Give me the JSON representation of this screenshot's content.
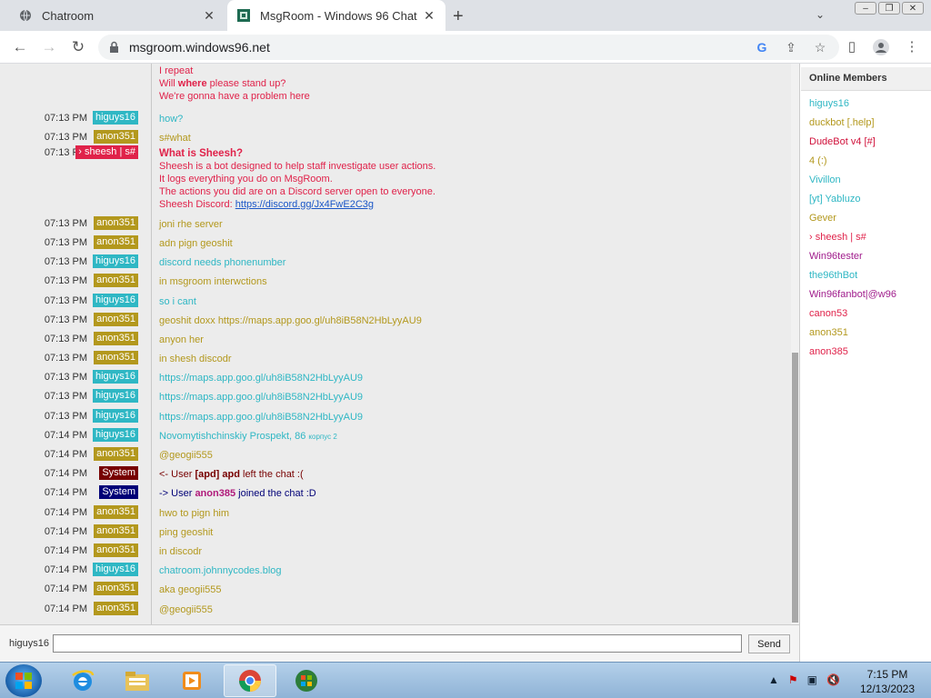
{
  "browser": {
    "tabs": [
      {
        "title": "Chatroom"
      },
      {
        "title": "MsgRoom - Windows 96 Chat"
      }
    ],
    "url": "msgroom.windows96.net"
  },
  "chat": {
    "top_lines": [
      {
        "text": "I repeat"
      },
      {
        "pre": "Will ",
        "bold": "where",
        "post": " please stand up?"
      },
      {
        "text": "We're gonna have a problem here"
      }
    ],
    "messages": [
      {
        "time": "07:13 PM",
        "user": "higuys16",
        "style": "hig",
        "text": "how?"
      },
      {
        "time": "07:13 PM",
        "user": "anon351",
        "style": "anon",
        "text": "s#what"
      },
      {
        "time": "07:13 PM",
        "user": "› sheesh | s#",
        "style": "shee",
        "title": "What is Sheesh?",
        "lines": [
          "Sheesh is a bot designed to help staff investigate user actions.",
          "It logs everything you do on MsgRoom.",
          "The actions you did are on a Discord server open to everyone."
        ],
        "link_label": "Sheesh Discord: ",
        "link": "https://discord.gg/Jx4FwE2C3g"
      },
      {
        "time": "07:13 PM",
        "user": "anon351",
        "style": "anon",
        "text": "joni rhe server"
      },
      {
        "time": "07:13 PM",
        "user": "anon351",
        "style": "anon",
        "text": "adn pign geoshit"
      },
      {
        "time": "07:13 PM",
        "user": "higuys16",
        "style": "hig",
        "text": "discord needs phonenumber"
      },
      {
        "time": "07:13 PM",
        "user": "anon351",
        "style": "anon",
        "text": "in msgroom interwctions"
      },
      {
        "time": "07:13 PM",
        "user": "higuys16",
        "style": "hig",
        "text": "so i cant"
      },
      {
        "time": "07:13 PM",
        "user": "anon351",
        "style": "anon",
        "text": "geoshit doxx https://maps.app.goo.gl/uh8iB58N2HbLyyAU9"
      },
      {
        "time": "07:13 PM",
        "user": "anon351",
        "style": "anon",
        "text": "anyon her"
      },
      {
        "time": "07:13 PM",
        "user": "anon351",
        "style": "anon",
        "text": "in shesh discodr"
      },
      {
        "time": "07:13 PM",
        "user": "higuys16",
        "style": "hig",
        "text": "https://maps.app.goo.gl/uh8iB58N2HbLyyAU9"
      },
      {
        "time": "07:13 PM",
        "user": "higuys16",
        "style": "hig",
        "text": "https://maps.app.goo.gl/uh8iB58N2HbLyyAU9"
      },
      {
        "time": "07:13 PM",
        "user": "higuys16",
        "style": "hig",
        "text": "https://maps.app.goo.gl/uh8iB58N2HbLyyAU9"
      },
      {
        "time": "07:14 PM",
        "user": "higuys16",
        "style": "hig",
        "text": "Novomytishchinskiy Prospekt, 86",
        "small": "корпус 2"
      },
      {
        "time": "07:14 PM",
        "user": "anon351",
        "style": "anon",
        "text": "@geogii555"
      },
      {
        "time": "07:14 PM",
        "user": "System",
        "style": "sys",
        "pre": "<- User ",
        "bold": "[apd] apd",
        "post": " left the chat :("
      },
      {
        "time": "07:14 PM",
        "user": "System",
        "style": "sys2",
        "pre": "-> User ",
        "bold": "anon385",
        "post": " joined the chat :D"
      },
      {
        "time": "07:14 PM",
        "user": "anon351",
        "style": "anon",
        "text": "hwo to pign him"
      },
      {
        "time": "07:14 PM",
        "user": "anon351",
        "style": "anon",
        "text": "ping geoshit"
      },
      {
        "time": "07:14 PM",
        "user": "anon351",
        "style": "anon",
        "text": "in discodr"
      },
      {
        "time": "07:14 PM",
        "user": "higuys16",
        "style": "hig",
        "text": "chatroom.johnnycodes.blog"
      },
      {
        "time": "07:14 PM",
        "user": "anon351",
        "style": "anon",
        "text": "aka geogii555"
      },
      {
        "time": "07:14 PM",
        "user": "anon351",
        "style": "anon",
        "text": "@geogii555"
      }
    ]
  },
  "sidebar": {
    "title": "Online Members",
    "members": [
      {
        "name": "higuys16",
        "color": "#2fb7c4"
      },
      {
        "name": "duckbot [.help]",
        "color": "#b3981d"
      },
      {
        "name": "DudeBot v4 [#]",
        "color": "#d0103a"
      },
      {
        "name": "4 (:)",
        "color": "#b3981d"
      },
      {
        "name": "Vivillon",
        "color": "#2fb7c4"
      },
      {
        "name": "[yt] Yabluzo",
        "color": "#2fb7c4"
      },
      {
        "name": "Gever",
        "color": "#b3981d"
      },
      {
        "name": "› sheesh | s#",
        "color": "#e0224a"
      },
      {
        "name": "Win96tester",
        "color": "#a01c8c"
      },
      {
        "name": "the96thBot",
        "color": "#2fb7c4"
      },
      {
        "name": "Win96fanbot|@w96",
        "color": "#a01c8c"
      },
      {
        "name": "canon53",
        "color": "#e0224a"
      },
      {
        "name": "anon351",
        "color": "#b3981d"
      },
      {
        "name": "anon385",
        "color": "#e0224a"
      }
    ]
  },
  "input": {
    "nick": "higuys16",
    "value": "",
    "send_label": "Send"
  },
  "taskbar": {
    "time": "7:15 PM",
    "date": "12/13/2023"
  },
  "colors": {
    "higuys": "#2fb7c4",
    "anon": "#b3981d",
    "sheesh": "#e0224a",
    "system_leave": "#770000",
    "system_join": "#000077"
  }
}
